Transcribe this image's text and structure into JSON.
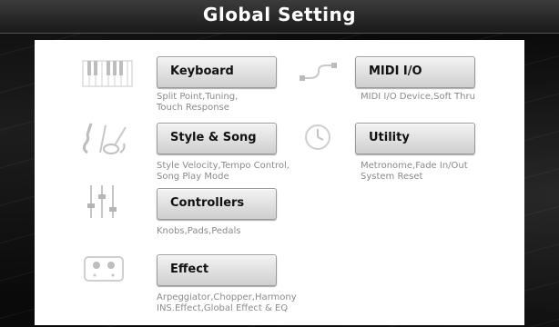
{
  "window": {
    "title": "Global Setting"
  },
  "items": [
    {
      "label": "Keyboard",
      "desc1": "Split Point,Tuning,",
      "desc2": "Touch Response",
      "icon": "keyboard-icon"
    },
    {
      "label": "MIDI I/O",
      "desc1": "MIDI I/O Device,Soft Thru",
      "desc2": "",
      "icon": "midi-cable-icon"
    },
    {
      "label": "Style & Song",
      "desc1": "Style Velocity,Tempo Control,",
      "desc2": "Song Play Mode",
      "icon": "instruments-icon"
    },
    {
      "label": "Utility",
      "desc1": "Metronome,Fade In/Out",
      "desc2": "System Reset",
      "icon": "clock-icon"
    },
    {
      "label": "Controllers",
      "desc1": "Knobs,Pads,Pedals",
      "desc2": "",
      "icon": "faders-icon"
    },
    {
      "label": "Effect",
      "desc1": "Arpeggiator,Chopper,Harmony",
      "desc2": "INS.Effect,Global Effect & EQ",
      "icon": "effect-pedal-icon"
    }
  ]
}
